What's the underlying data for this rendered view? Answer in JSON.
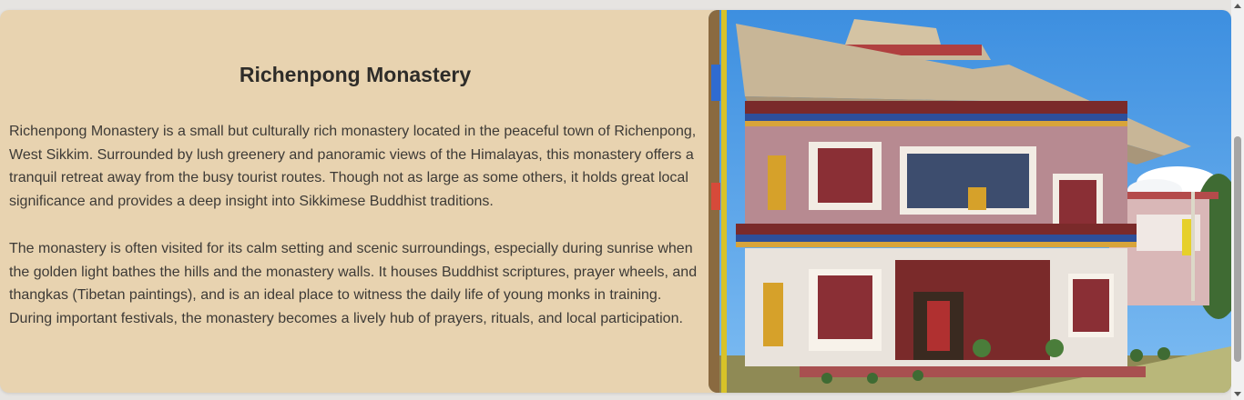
{
  "section": {
    "title": "Richenpong Monastery",
    "paragraphs": [
      "Richenpong Monastery is a small but culturally rich monastery located in the peaceful town of Richenpong, West Sikkim. Surrounded by lush greenery and panoramic views of the Himalayas, this monastery offers a tranquil retreat away from the busy tourist routes. Though not as large as some others, it holds great local significance and provides a deep insight into Sikkimese Buddhist traditions.",
      "The monastery is often visited for its calm setting and scenic surroundings, especially during sunrise when the golden light bathes the hills and the monastery walls. It houses Buddhist scriptures, prayer wheels, and thangkas (Tibetan paintings), and is an ideal place to witness the daily life of young monks in training. During important festivals, the monastery becomes a lively hub of prayers, rituals, and local participation."
    ]
  },
  "colors": {
    "card_background": "#e8d3b0",
    "page_background": "#e6e4e1",
    "title_text": "#2e2c29",
    "body_text": "#3d3a36"
  },
  "icons": {
    "scroll_up": "scroll-up-arrow-icon",
    "scroll_down": "scroll-down-arrow-icon"
  }
}
